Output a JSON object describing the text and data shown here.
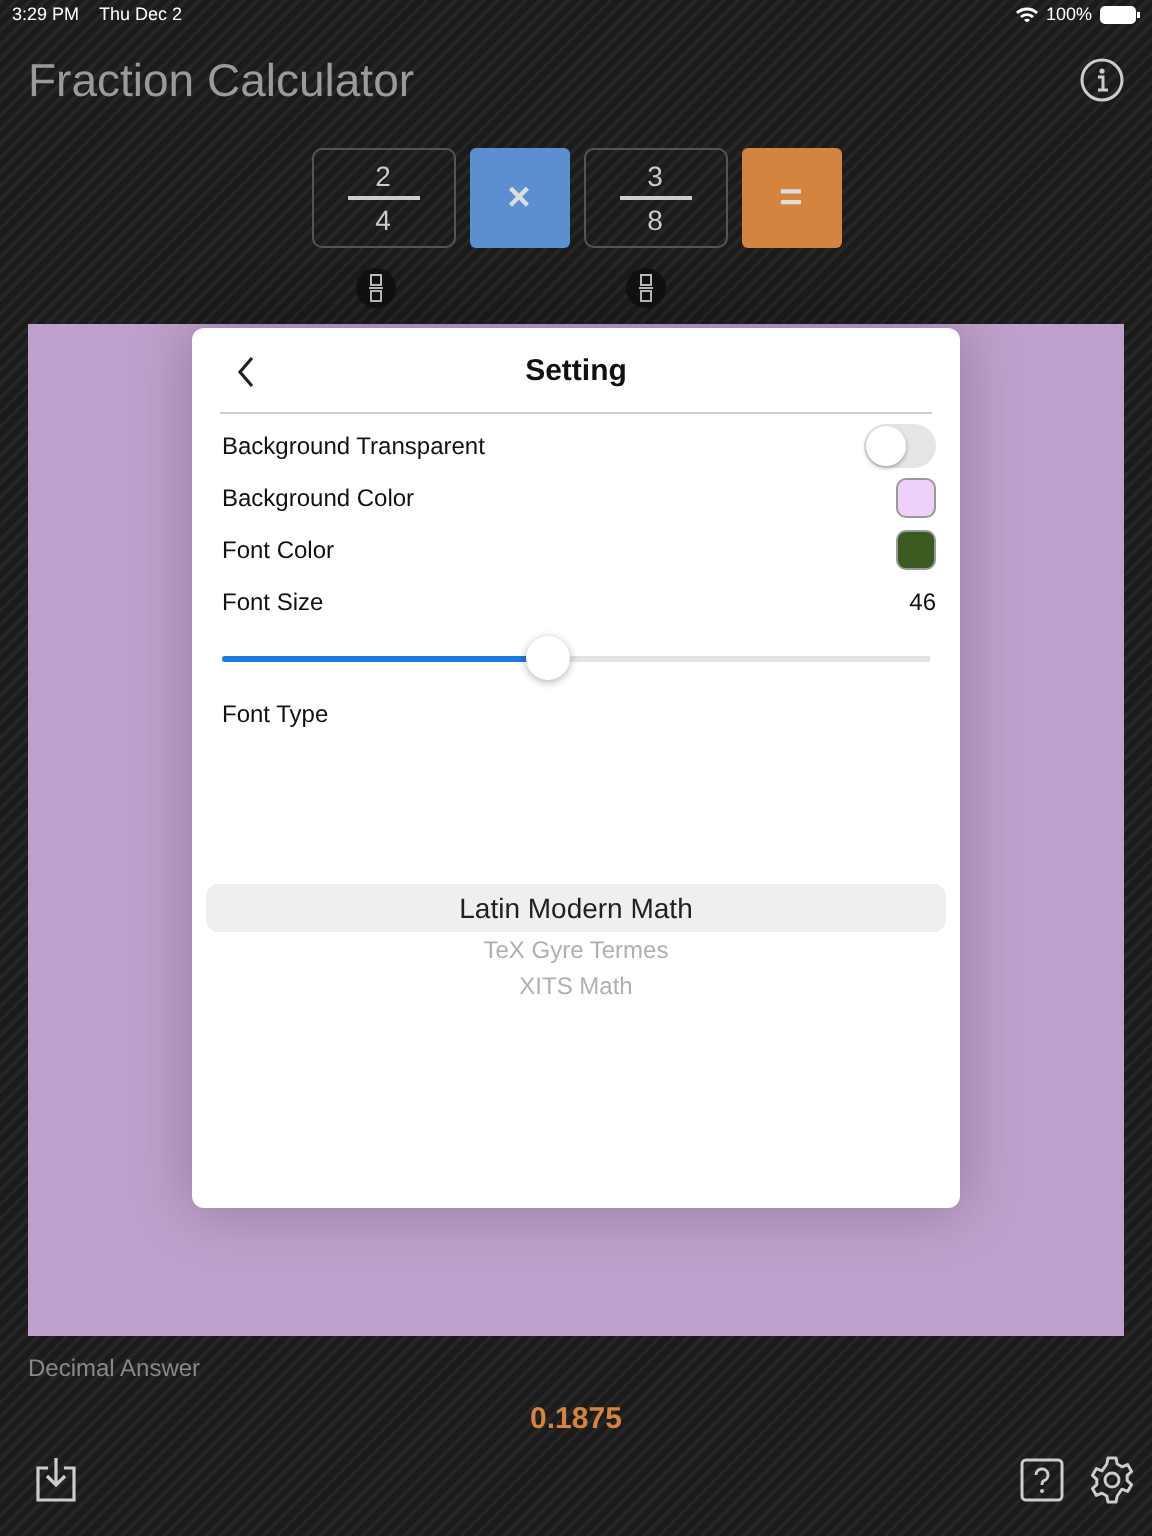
{
  "status_bar": {
    "time": "3:29 PM",
    "date": "Thu Dec 2",
    "battery": "100%"
  },
  "title": "Fraction Calculator",
  "fractions": [
    {
      "numerator": "2",
      "denominator": "4"
    },
    {
      "numerator": "3",
      "denominator": "8"
    }
  ],
  "operator": "×",
  "equals": "=",
  "settings": {
    "title": "Setting",
    "rows": [
      {
        "kind": "toggle",
        "label": "Background Transparent",
        "on": false
      },
      {
        "kind": "color",
        "label": "Background Color",
        "color": "#efd0fa"
      },
      {
        "kind": "color",
        "label": "Font Color",
        "color": "#3b5a1f"
      },
      {
        "kind": "value",
        "label": "Font Size",
        "value": "46"
      },
      {
        "kind": "slider",
        "level": 0.46
      },
      {
        "kind": "heading",
        "label": "Font Type"
      }
    ],
    "font_types": [
      {
        "label": "Latin Modern Math",
        "selected": true
      },
      {
        "label": "TeX Gyre Termes",
        "selected": false
      },
      {
        "label": "XITS Math",
        "selected": false
      }
    ]
  },
  "answer_label": "Decimal Answer",
  "answer": "0.1875"
}
